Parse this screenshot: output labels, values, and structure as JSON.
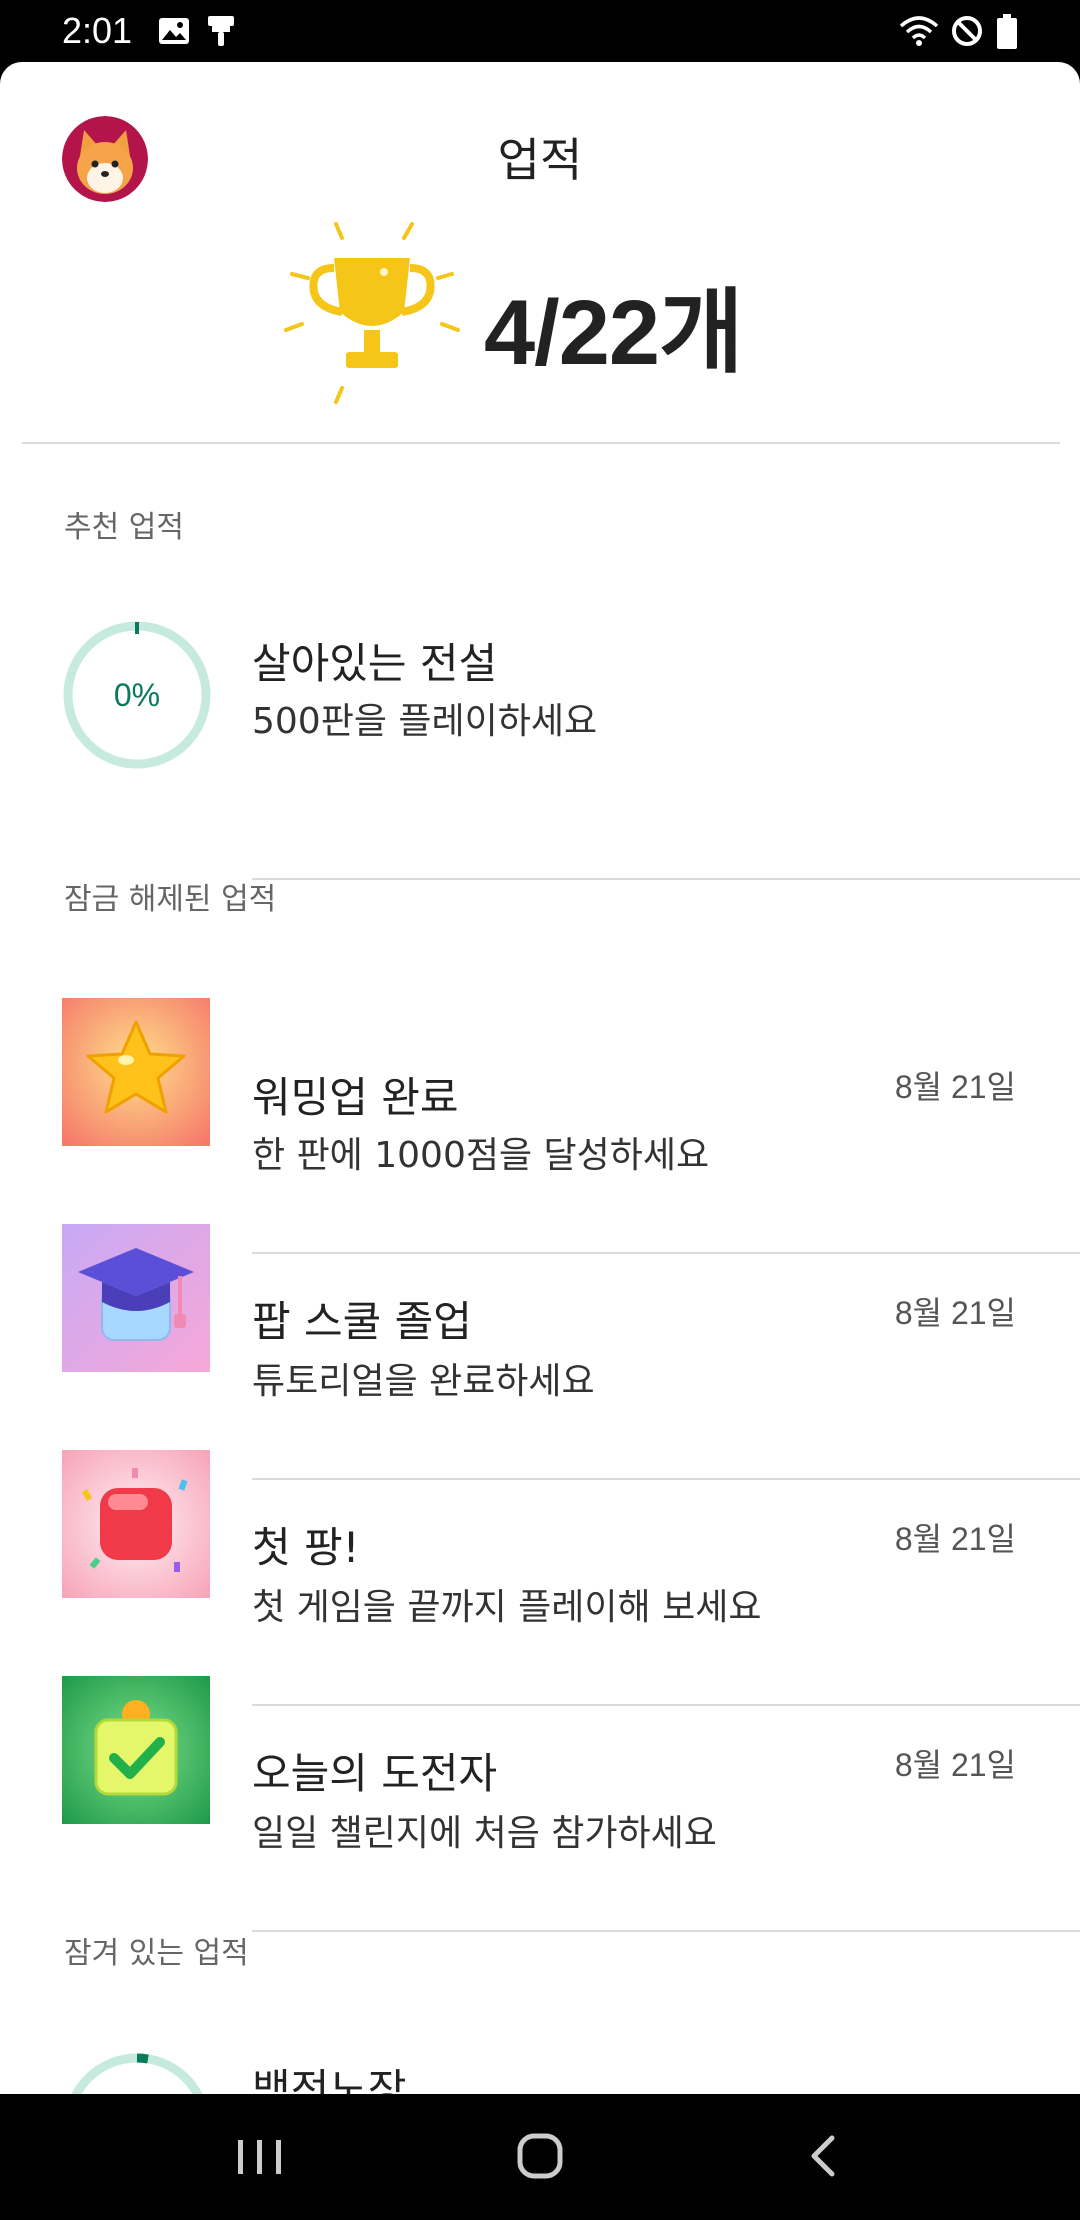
{
  "status_bar": {
    "time": "2:01"
  },
  "header": {
    "title": "업적",
    "count": "4/22개"
  },
  "sections": {
    "recommended": "추천 업적",
    "unlocked": "잠금 해제된 업적",
    "locked": "잠겨 있는 업적"
  },
  "recommended": {
    "percent": "0%",
    "progress": 0,
    "title": "살아있는 전설",
    "desc": "500판을 플레이하세요"
  },
  "unlocked_items": [
    {
      "title": "워밍업 완료",
      "desc": "한 판에 1000점을 달성하세요",
      "date": "8월 21일",
      "icon": "star-icon"
    },
    {
      "title": "팝 스쿨 졸업",
      "desc": "튜토리얼을 완료하세요",
      "date": "8월 21일",
      "icon": "graduation-cap-icon"
    },
    {
      "title": "첫 팡!",
      "desc": "첫 게임을 끝까지 플레이해 보세요",
      "date": "8월 21일",
      "icon": "red-block-icon"
    },
    {
      "title": "오늘의 도전자",
      "desc": "일일 챌린지에 처음 참가하세요",
      "date": "8월 21일",
      "icon": "calendar-check-icon"
    }
  ],
  "locked_preview": {
    "title": "백전노장"
  },
  "colors": {
    "ring_track": "#c6ebde",
    "ring_fill": "#0b7a5a",
    "trophy": "#f5c518"
  }
}
